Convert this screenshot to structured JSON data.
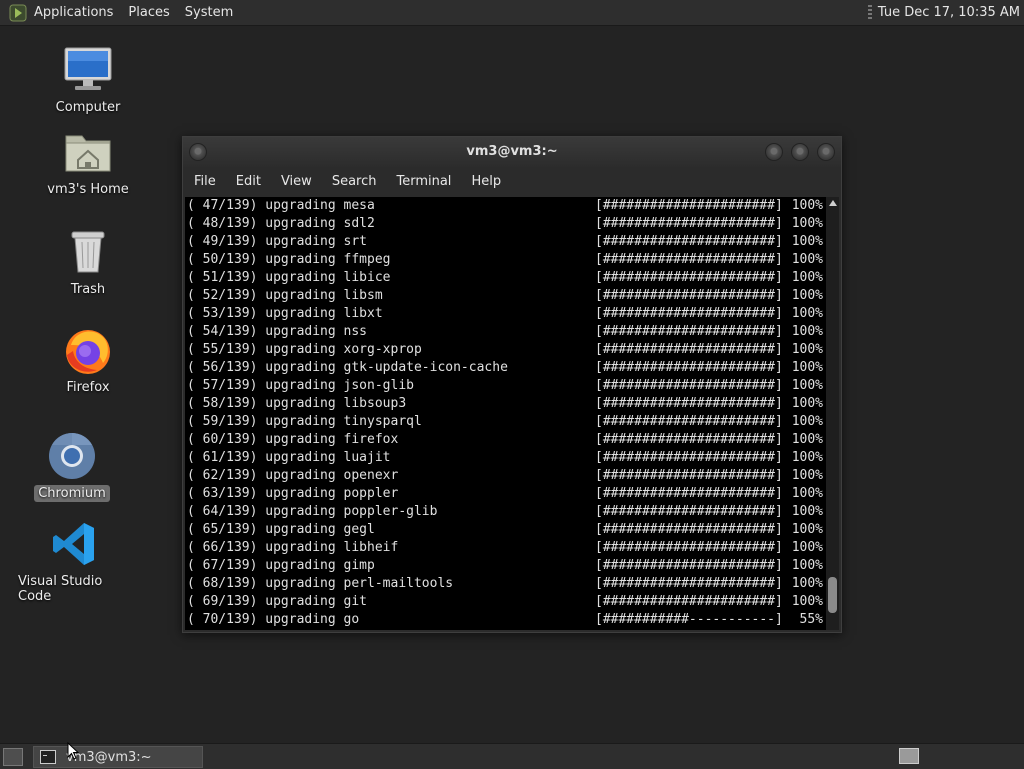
{
  "top_panel": {
    "menus": [
      "Applications",
      "Places",
      "System"
    ],
    "clock": "Tue Dec 17, 10:35 AM"
  },
  "desktop": {
    "icons": [
      {
        "label": "Computer",
        "icon": "computer-icon"
      },
      {
        "label": "vm3's Home",
        "icon": "home-folder-icon"
      },
      {
        "label": "Trash",
        "icon": "trash-icon"
      },
      {
        "label": "Firefox",
        "icon": "firefox-icon"
      },
      {
        "label": "Chromium",
        "icon": "chromium-icon"
      },
      {
        "label": "Visual Studio Code",
        "icon": "vscode-icon"
      }
    ]
  },
  "terminal": {
    "title": "vm3@vm3:~",
    "menu": [
      "File",
      "Edit",
      "View",
      "Search",
      "Terminal",
      "Help"
    ],
    "lines": [
      {
        "text": "( 47/139) upgrading mesa",
        "bar": "[######################]",
        "pct": "100%"
      },
      {
        "text": "( 48/139) upgrading sdl2",
        "bar": "[######################]",
        "pct": "100%"
      },
      {
        "text": "( 49/139) upgrading srt",
        "bar": "[######################]",
        "pct": "100%"
      },
      {
        "text": "( 50/139) upgrading ffmpeg",
        "bar": "[######################]",
        "pct": "100%"
      },
      {
        "text": "( 51/139) upgrading libice",
        "bar": "[######################]",
        "pct": "100%"
      },
      {
        "text": "( 52/139) upgrading libsm",
        "bar": "[######################]",
        "pct": "100%"
      },
      {
        "text": "( 53/139) upgrading libxt",
        "bar": "[######################]",
        "pct": "100%"
      },
      {
        "text": "( 54/139) upgrading nss",
        "bar": "[######################]",
        "pct": "100%"
      },
      {
        "text": "( 55/139) upgrading xorg-xprop",
        "bar": "[######################]",
        "pct": "100%"
      },
      {
        "text": "( 56/139) upgrading gtk-update-icon-cache",
        "bar": "[######################]",
        "pct": "100%"
      },
      {
        "text": "( 57/139) upgrading json-glib",
        "bar": "[######################]",
        "pct": "100%"
      },
      {
        "text": "( 58/139) upgrading libsoup3",
        "bar": "[######################]",
        "pct": "100%"
      },
      {
        "text": "( 59/139) upgrading tinysparql",
        "bar": "[######################]",
        "pct": "100%"
      },
      {
        "text": "( 60/139) upgrading firefox",
        "bar": "[######################]",
        "pct": "100%"
      },
      {
        "text": "( 61/139) upgrading luajit",
        "bar": "[######################]",
        "pct": "100%"
      },
      {
        "text": "( 62/139) upgrading openexr",
        "bar": "[######################]",
        "pct": "100%"
      },
      {
        "text": "( 63/139) upgrading poppler",
        "bar": "[######################]",
        "pct": "100%"
      },
      {
        "text": "( 64/139) upgrading poppler-glib",
        "bar": "[######################]",
        "pct": "100%"
      },
      {
        "text": "( 65/139) upgrading gegl",
        "bar": "[######################]",
        "pct": "100%"
      },
      {
        "text": "( 66/139) upgrading libheif",
        "bar": "[######################]",
        "pct": "100%"
      },
      {
        "text": "( 67/139) upgrading gimp",
        "bar": "[######################]",
        "pct": "100%"
      },
      {
        "text": "( 68/139) upgrading perl-mailtools",
        "bar": "[######################]",
        "pct": "100%"
      },
      {
        "text": "( 69/139) upgrading git",
        "bar": "[######################]",
        "pct": "100%"
      },
      {
        "text": "( 70/139) upgrading go",
        "bar": "[###########-----------]",
        "pct": "55%"
      }
    ]
  },
  "taskbar": {
    "task_title": "vm3@vm3:~"
  },
  "colors": {
    "desktop_bg": "#232323",
    "panel_bg": "#2e2e2e",
    "terminal_bg": "#000000"
  }
}
